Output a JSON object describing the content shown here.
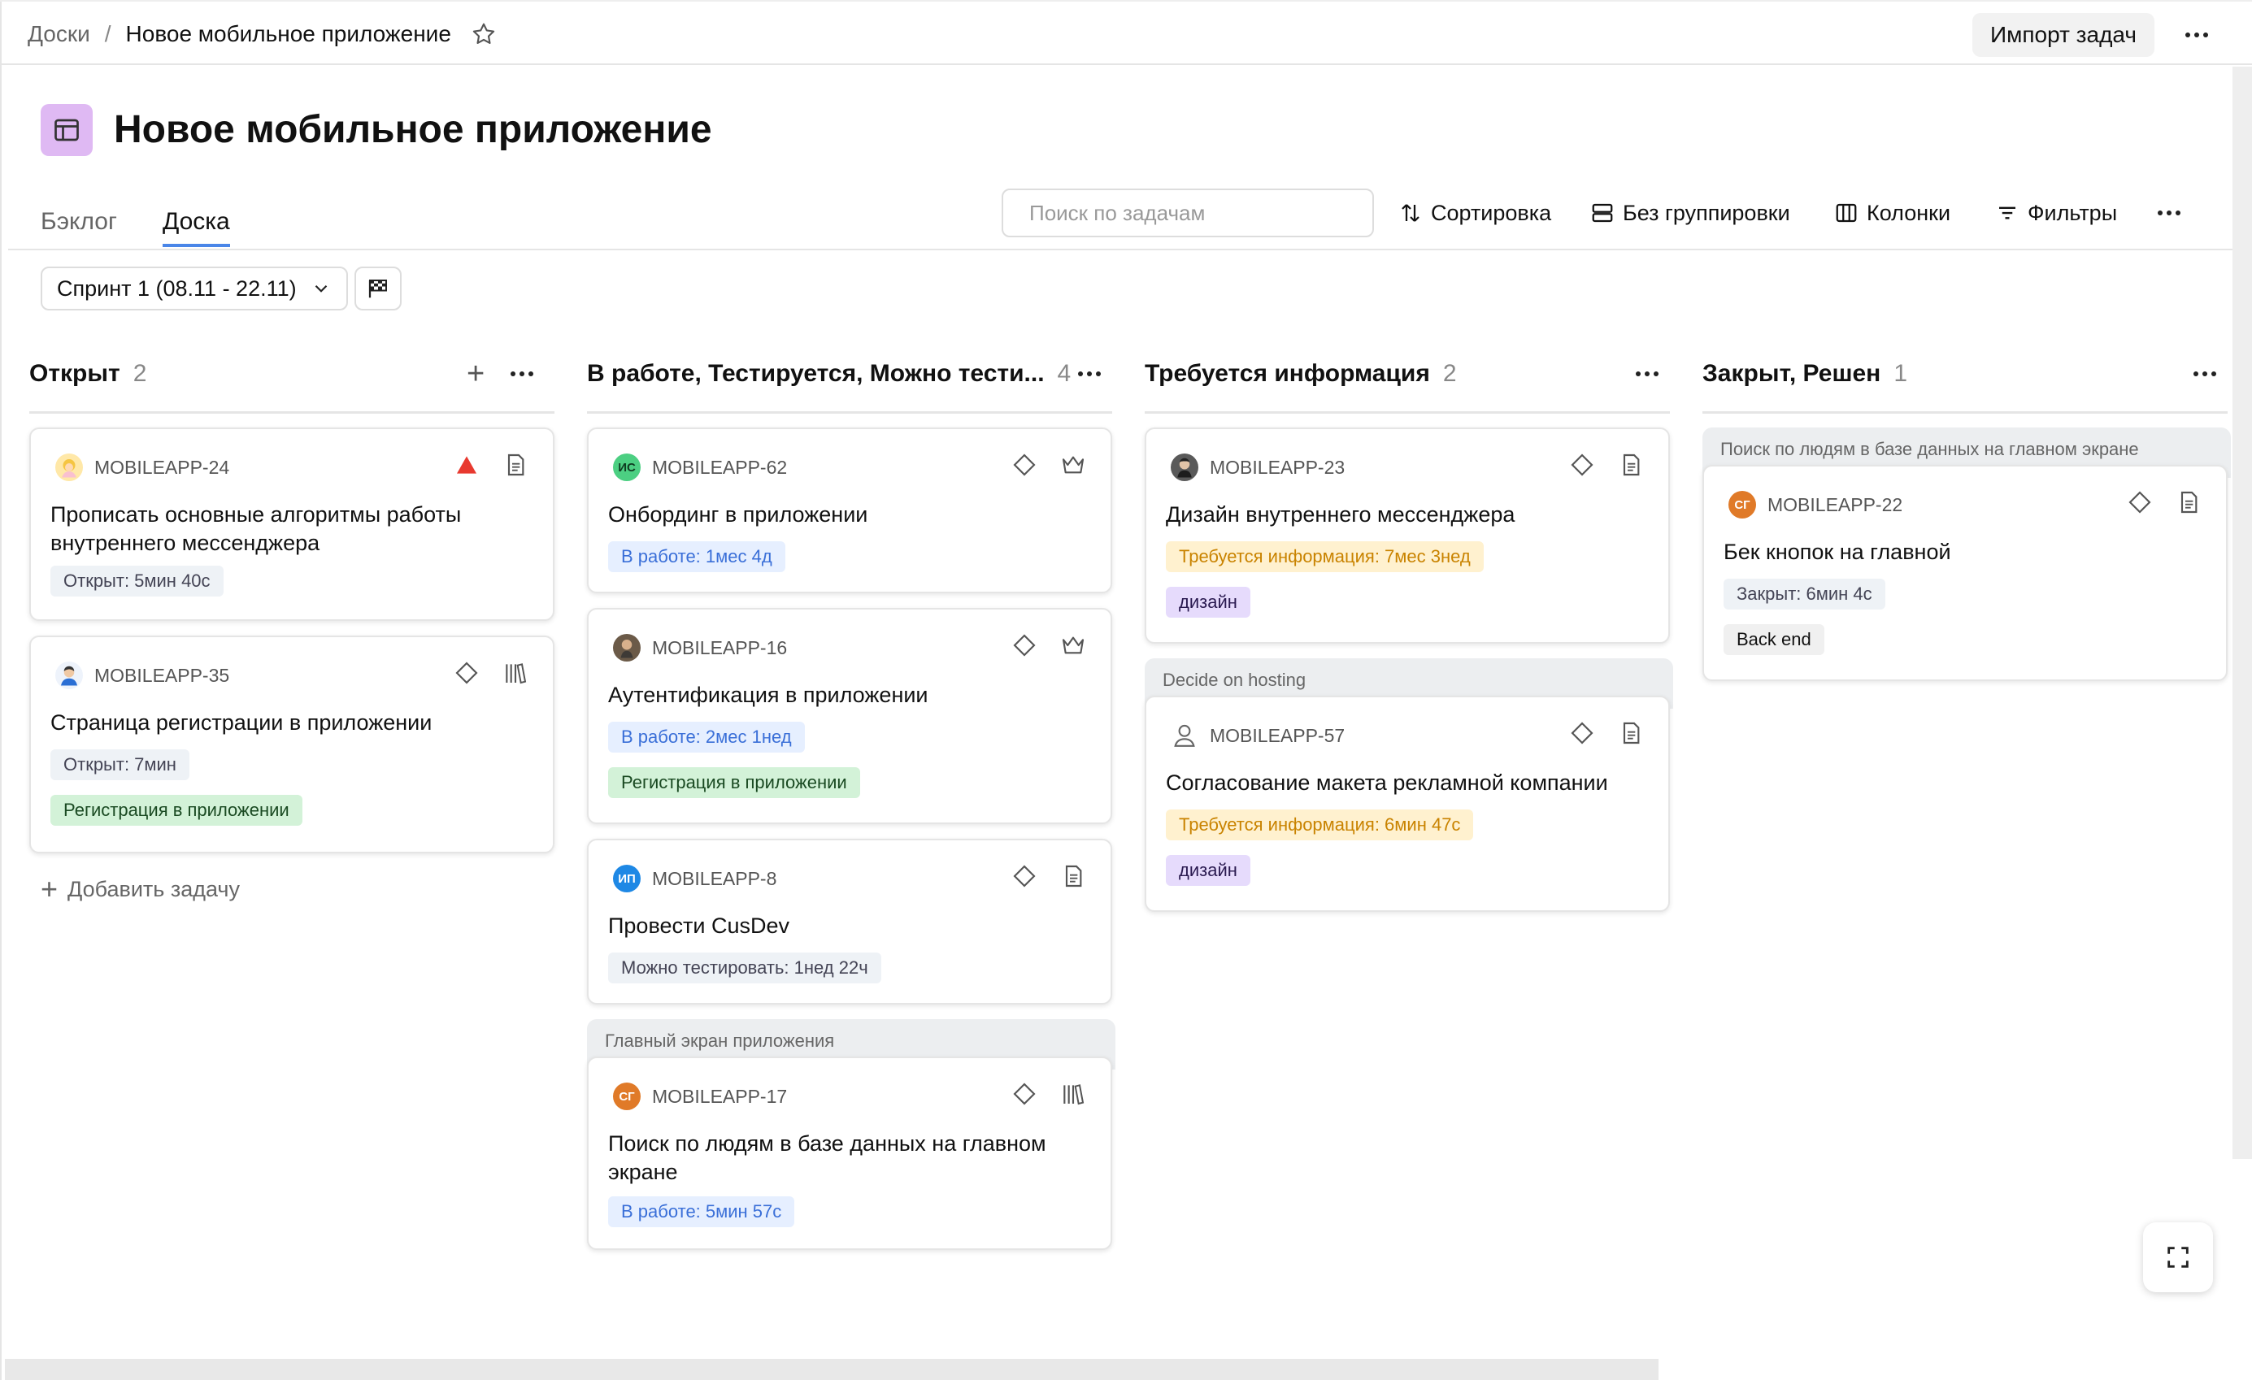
{
  "breadcrumb": {
    "root": "Доски",
    "separator": "/",
    "current": "Новое мобильное приложение"
  },
  "header": {
    "import_label": "Импорт задач"
  },
  "page": {
    "title": "Новое мобильное приложение"
  },
  "tabs": [
    {
      "label": "Бэклог",
      "active": false
    },
    {
      "label": "Доска",
      "active": true
    }
  ],
  "search": {
    "placeholder": "Поиск по задачам"
  },
  "toolbar": {
    "sort": "Сортировка",
    "group": "Без группировки",
    "columns": "Колонки",
    "filters": "Фильтры"
  },
  "sprint": {
    "label": "Спринт 1 (08.11 - 22.11)"
  },
  "columns": [
    {
      "title": "Открыт",
      "count": "2"
    },
    {
      "title": "В работе, Тестируется, Можно тести...",
      "count": "4"
    },
    {
      "title": "Требуется информация",
      "count": "2"
    },
    {
      "title": "Закрыт, Решен",
      "count": "1"
    }
  ],
  "add_task": "Добавить задачу",
  "groups": {
    "g17": "Главный экран приложения",
    "g57": "Decide on hosting",
    "g22": "Поиск по людям в базе данных на главном экране"
  },
  "cards": {
    "c24": {
      "key": "MOBILEAPP-24",
      "title": "Прописать основные алгоритмы работы внутреннего мессенджера",
      "status": "Открыт: 5мин 40с"
    },
    "c35": {
      "key": "MOBILEAPP-35",
      "title": "Страница регистрации в приложении",
      "status": "Открыт: 7мин",
      "tag": "Регистрация в приложении"
    },
    "c62": {
      "key": "MOBILEAPP-62",
      "avatar": "ИС",
      "title": "Онбординг в приложении",
      "status": "В работе: 1мес 4д"
    },
    "c16": {
      "key": "MOBILEAPP-16",
      "title": "Аутентификация в приложении",
      "status": "В работе: 2мес 1нед",
      "tag": "Регистрация в приложении"
    },
    "c8": {
      "key": "MOBILEAPP-8",
      "avatar": "ИП",
      "title": "Провести CusDev",
      "status": "Можно тестировать: 1нед 22ч"
    },
    "c17": {
      "key": "MOBILEAPP-17",
      "avatar": "СГ",
      "title": "Поиск по людям в базе данных на главном экране",
      "status": "В работе: 5мин 57с"
    },
    "c23": {
      "key": "MOBILEAPP-23",
      "title": "Дизайн внутреннего мессенджера",
      "status": "Требуется информация: 7мес 3нед",
      "tag": "дизайн"
    },
    "c57": {
      "key": "MOBILEAPP-57",
      "title": "Согласование макета рекламной компании",
      "status": "Требуется информация: 6мин 47с",
      "tag": "дизайн"
    },
    "c22": {
      "key": "MOBILEAPP-22",
      "avatar": "СГ",
      "title": "Бек кнопок на главной",
      "status": "Закрыт: 6мин 4с",
      "tag": "Back end"
    }
  },
  "colors": {
    "accent": "#4a86e8",
    "priority_critical": "#e8392f",
    "board_icon_bg": "#dfb9f3",
    "avatar_teal": "#4ccf82",
    "avatar_blue": "#1e88e5",
    "avatar_orange": "#e07a28"
  },
  "icons": [
    "star-icon",
    "board-icon",
    "sort-icon",
    "group-icon",
    "columns-icon",
    "filter-icon",
    "chevron-down-icon",
    "finish-flag-icon",
    "priority-critical-icon",
    "priority-normal-icon",
    "task-type-icon",
    "epic-icon",
    "story-icon",
    "user-icon",
    "fullscreen-icon"
  ]
}
